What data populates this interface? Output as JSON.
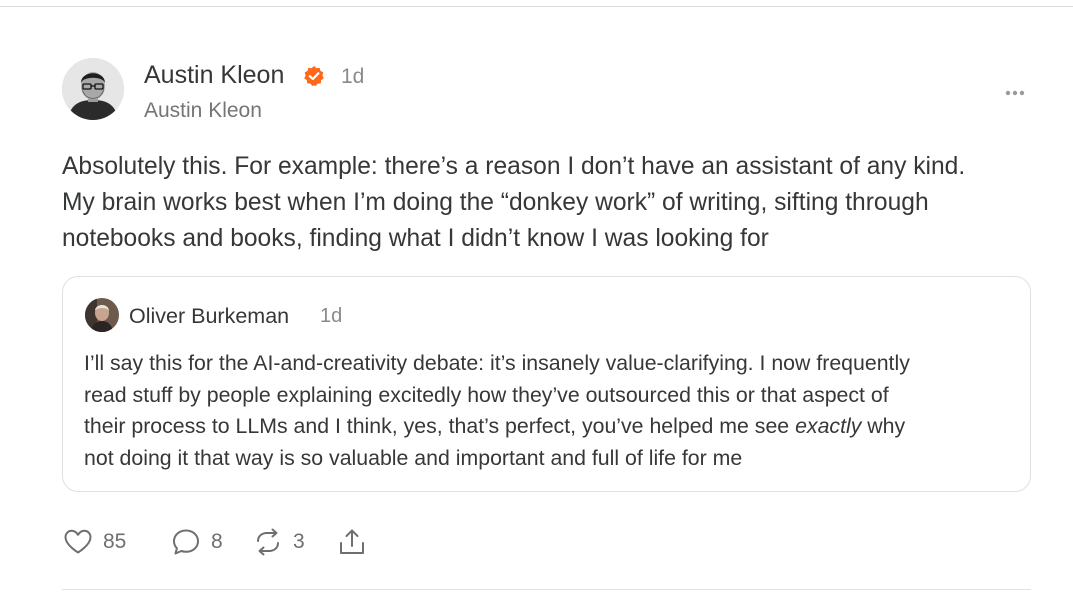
{
  "post": {
    "author_name": "Austin Kleon",
    "author_handle": "Austin Kleon",
    "time": "1d",
    "body_lines": [
      "Absolutely this. For example: there’s a reason I don’t have an assistant of any kind.",
      "My brain works best when I’m doing the “donkey work” of writing, sifting through",
      "notebooks and books, finding what I didn’t know I was looking for"
    ]
  },
  "quote": {
    "author_name": "Oliver Burkeman",
    "time": "1d",
    "line1": "I’ll say this for the AI-and-creativity debate: it’s insanely value-clarifying. I now frequently",
    "line2": "read stuff by people explaining excitedly how they’ve outsourced this or that aspect of",
    "line3_before": "their process to LLMs and I think, yes, that’s perfect, you’ve helped me see ",
    "line3_emphasis": "exactly",
    "line3_after": " why",
    "line4": "not doing it that way is so valuable and important and full of life for me"
  },
  "actions": {
    "likes": "85",
    "comments": "8",
    "restacks": "3"
  },
  "colors": {
    "verified_badge": "#ff6719",
    "text": "#363737",
    "muted": "#8a8a8a"
  },
  "icons": [
    "verified-icon",
    "more-icon",
    "heart-icon",
    "comment-icon",
    "restack-icon",
    "share-icon"
  ]
}
